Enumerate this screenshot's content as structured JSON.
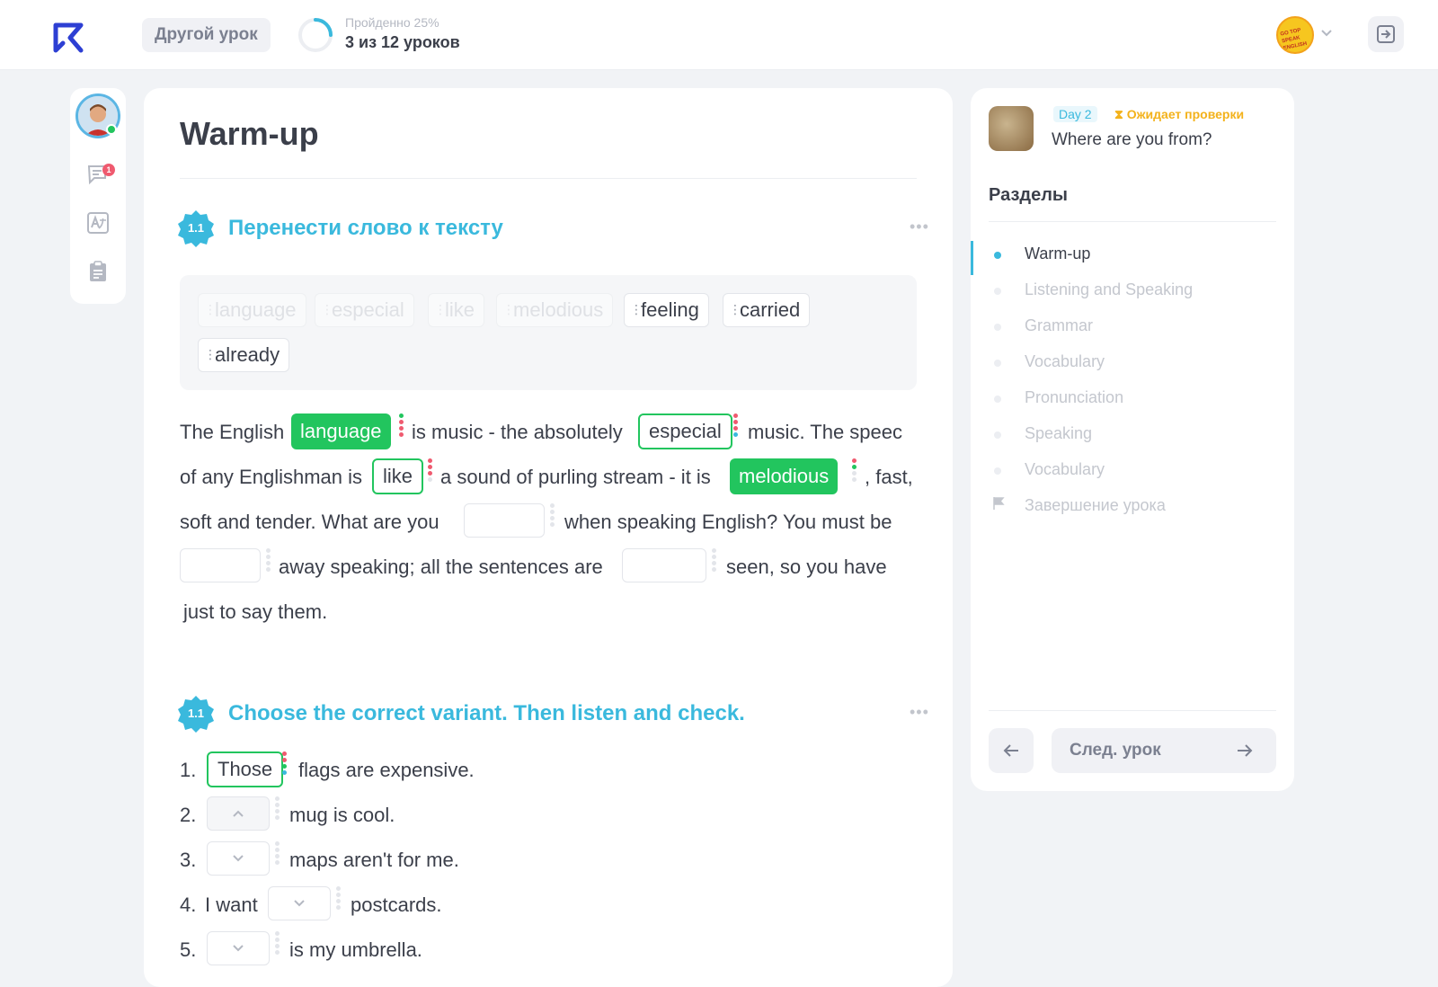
{
  "header": {
    "other_lesson_label": "Другой урок",
    "progress_label": "Пройденно 25%",
    "progress_fraction": 0.25,
    "progress_count": "3 из 12 уроков",
    "avatar_text": "GO TOP SPEAK ENGLISH"
  },
  "rail": {
    "notification_count": "1"
  },
  "main": {
    "title": "Warm-up",
    "task1": {
      "number": "1.1",
      "title": "Перенести слово к тексту",
      "bank": [
        {
          "word": "language",
          "used": true
        },
        {
          "word": "especial",
          "used": true
        },
        {
          "word": "like",
          "used": true
        },
        {
          "word": "melodious",
          "used": true
        },
        {
          "word": "feeling",
          "used": false
        },
        {
          "word": "carried",
          "used": false
        },
        {
          "word": "already",
          "used": false
        }
      ],
      "text": {
        "l1a": "The English",
        "f1": "language",
        "l1b": "is music - the absolutely",
        "f2": "especial",
        "l1c": "music.  The speec",
        "l2a": "of any Englishman is",
        "f3": "like",
        "l2b": "a sound of purling stream - it is",
        "f4": "melodious",
        "l2c": ", fast,",
        "l3a": "soft and tender.  What are you",
        "l3b": "when speaking English?  You must be",
        "l4a": "away speaking;  all the sentences are",
        "l4b": "seen, so you have",
        "l5": "just to say them."
      }
    },
    "task2": {
      "number": "1.1",
      "title": "Choose the correct variant. Then listen and check.",
      "items": [
        {
          "n": "1.",
          "pre": "",
          "choice": "Those",
          "post": "flags are expensive."
        },
        {
          "n": "2.",
          "pre": "",
          "choice": "",
          "post": "mug is cool."
        },
        {
          "n": "3.",
          "pre": "",
          "choice": "",
          "post": "maps aren't for me."
        },
        {
          "n": "4.",
          "pre": "I want",
          "choice": "",
          "post": "postcards."
        },
        {
          "n": "5.",
          "pre": "",
          "choice": "",
          "post": "is my umbrella."
        }
      ]
    }
  },
  "sidebar": {
    "day": "Day 2",
    "status": "Ожидает проверки",
    "lesson_title": "Where are you from?",
    "sections_heading": "Разделы",
    "sections": [
      {
        "label": "Warm-up",
        "active": true
      },
      {
        "label": "Listening and Speaking",
        "active": false
      },
      {
        "label": "Grammar",
        "active": false
      },
      {
        "label": "Vocabulary",
        "active": false
      },
      {
        "label": "Pronunciation",
        "active": false
      },
      {
        "label": "Speaking",
        "active": false
      },
      {
        "label": "Vocabulary",
        "active": false
      },
      {
        "label": "Завершение урока",
        "active": false
      }
    ],
    "next_label": "След. урок"
  },
  "colors": {
    "accent": "#3ab9dd",
    "success": "#22c55e",
    "warning": "#f3b21b"
  }
}
